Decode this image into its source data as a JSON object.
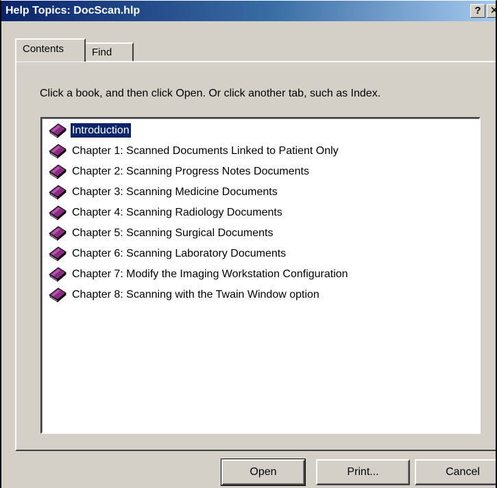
{
  "window": {
    "title": "Help Topics: DocScan.hlp",
    "help_button": "?",
    "close_button": "✕"
  },
  "tabs": [
    {
      "label": "Contents",
      "active": true
    },
    {
      "label": "Find",
      "active": false
    }
  ],
  "instructions": "Click a book, and then click Open. Or click another tab, such as Index.",
  "tree": {
    "icon": "closed-book-icon",
    "selected_index": 0,
    "items": [
      {
        "label": "Introduction"
      },
      {
        "label": "Chapter 1: Scanned Documents Linked to Patient Only"
      },
      {
        "label": "Chapter 2: Scanning Progress Notes Documents"
      },
      {
        "label": "Chapter 3: Scanning Medicine Documents"
      },
      {
        "label": "Chapter 4: Scanning Radiology Documents"
      },
      {
        "label": "Chapter 5: Scanning Surgical Documents"
      },
      {
        "label": "Chapter 6: Scanning Laboratory Documents"
      },
      {
        "label": "Chapter 7: Modify the Imaging Workstation Configuration"
      },
      {
        "label": "Chapter 8: Scanning with the Twain Window option"
      }
    ]
  },
  "buttons": {
    "open": "Open",
    "print": "Print...",
    "cancel": "Cancel"
  },
  "colors": {
    "title_bar_start": "#0a246a",
    "title_bar_end": "#a6caf0",
    "dialog_face": "#d4d0c8",
    "selection": "#0a246a",
    "book_cover": "#7a1e6e"
  }
}
